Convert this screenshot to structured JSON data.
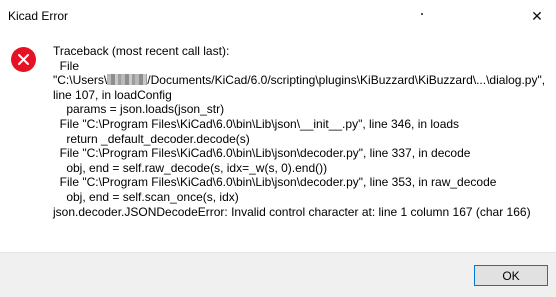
{
  "window": {
    "title": "Kicad Error",
    "close_glyph": "✕",
    "colors": {
      "error": "#e81123",
      "accent": "#0078d7",
      "footer_bg": "#f0f0f0"
    }
  },
  "error_icon": {
    "name": "error-icon",
    "glyph": "✕"
  },
  "traceback": {
    "line_01": "Traceback (most recent call last):",
    "line_02": "  File",
    "line_03_before": "\"C:\\Users\\",
    "line_03_after": "/Documents/KiCad/6.0/scripting\\plugins\\KiBuzzard\\KiBuzzard\\...\\dialog.py\",",
    "line_04": "line 107, in loadConfig",
    "line_05": "    params = json.loads(json_str)",
    "line_06": "  File \"C:\\Program Files\\KiCad\\6.0\\bin\\Lib\\json\\__init__.py\", line 346, in loads",
    "line_07": "    return _default_decoder.decode(s)",
    "line_08": "  File \"C:\\Program Files\\KiCad\\6.0\\bin\\Lib\\json\\decoder.py\", line 337, in decode",
    "line_09": "    obj, end = self.raw_decode(s, idx=_w(s, 0).end())",
    "line_10": "  File \"C:\\Program Files\\KiCad\\6.0\\bin\\Lib\\json\\decoder.py\", line 353, in raw_decode",
    "line_11": "    obj, end = self.scan_once(s, idx)",
    "line_12": "json.decoder.JSONDecodeError: Invalid control character at: line 1 column 167 (char 166)"
  },
  "buttons": {
    "ok_label": "OK"
  }
}
